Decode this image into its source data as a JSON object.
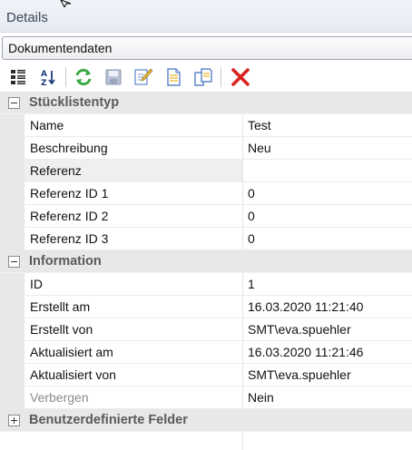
{
  "panel": {
    "title": "Details"
  },
  "selector": {
    "value": "Dokumentendaten"
  },
  "toolbar": {
    "buttons": [
      {
        "icon": "categorized-icon"
      },
      {
        "icon": "sort-alphabetical-icon"
      },
      {
        "icon": "refresh-icon"
      },
      {
        "icon": "save-icon"
      },
      {
        "icon": "edit-icon"
      },
      {
        "icon": "document-icon"
      },
      {
        "icon": "copy-icon"
      },
      {
        "icon": "delete-icon"
      }
    ]
  },
  "grid": {
    "categories": [
      {
        "label": "Stücklistentyp",
        "expanded": true,
        "properties": [
          {
            "name": "Name",
            "value": "Test"
          },
          {
            "name": "Beschreibung",
            "value": "Neu"
          },
          {
            "name": "Referenz",
            "value": ""
          },
          {
            "name": "Referenz ID 1",
            "value": "0"
          },
          {
            "name": "Referenz ID 2",
            "value": "0"
          },
          {
            "name": "Referenz ID 3",
            "value": "0"
          }
        ]
      },
      {
        "label": "Information",
        "expanded": true,
        "properties": [
          {
            "name": "ID",
            "value": "1"
          },
          {
            "name": "Erstellt am",
            "value": "16.03.2020 11:21:40"
          },
          {
            "name": "Erstellt von",
            "value": "SMT\\eva.spuehler"
          },
          {
            "name": "Aktualisiert am",
            "value": "16.03.2020 11:21:46"
          },
          {
            "name": "Aktualisiert von",
            "value": "SMT\\eva.spuehler"
          },
          {
            "name": "Verbergen",
            "value": "Nein"
          }
        ]
      },
      {
        "label": "Benutzerdefinierte Felder",
        "expanded": false,
        "properties": []
      }
    ]
  }
}
